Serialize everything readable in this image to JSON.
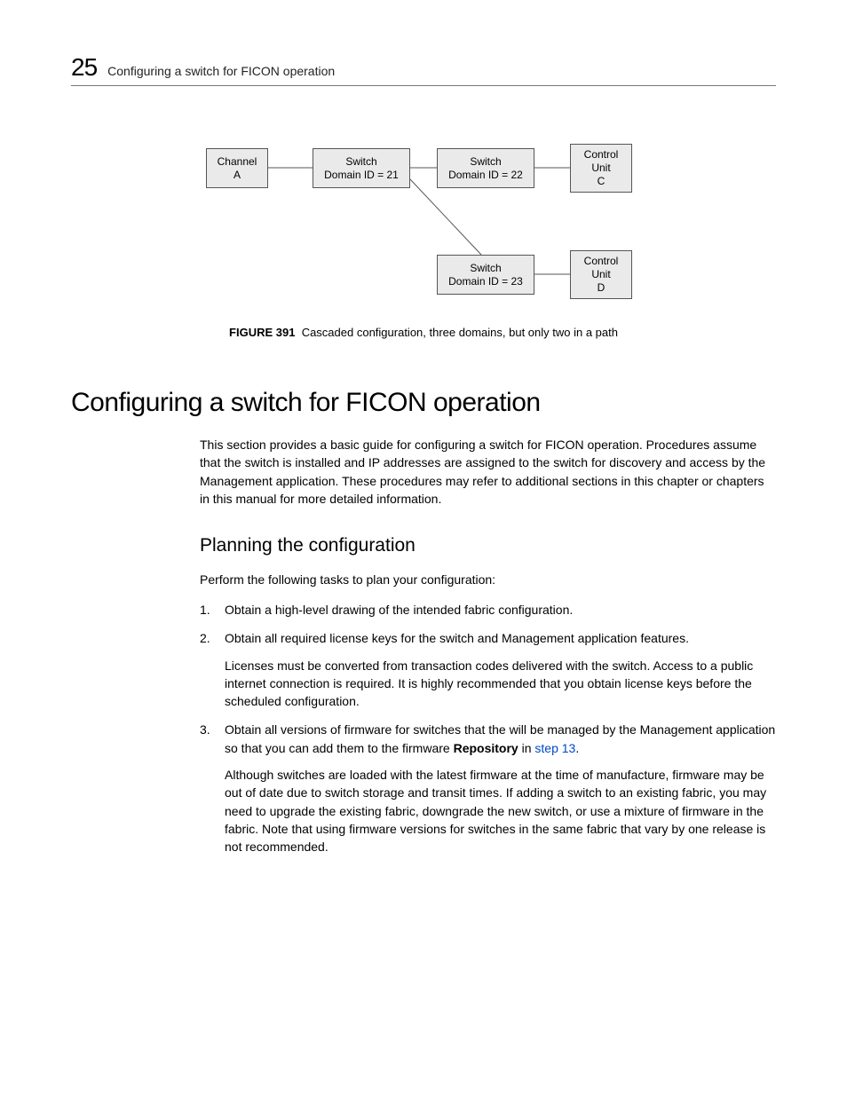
{
  "header": {
    "chapter": "25",
    "title": "Configuring a switch for FICON operation"
  },
  "chart_data": {
    "type": "diagram",
    "nodes": [
      {
        "id": "channelA",
        "lines": [
          "Channel",
          "A"
        ]
      },
      {
        "id": "sw21",
        "lines": [
          "Switch",
          "Domain ID = 21"
        ]
      },
      {
        "id": "sw22",
        "lines": [
          "Switch",
          "Domain ID = 22"
        ]
      },
      {
        "id": "cuC",
        "lines": [
          "Control",
          "Unit",
          "C"
        ]
      },
      {
        "id": "sw23",
        "lines": [
          "Switch",
          "Domain ID = 23"
        ]
      },
      {
        "id": "cuD",
        "lines": [
          "Control",
          "Unit",
          "D"
        ]
      }
    ],
    "edges": [
      [
        "channelA",
        "sw21"
      ],
      [
        "sw21",
        "sw22"
      ],
      [
        "sw22",
        "cuC"
      ],
      [
        "sw21",
        "sw23"
      ],
      [
        "sw23",
        "cuD"
      ]
    ]
  },
  "figure": {
    "label": "FIGURE 391",
    "caption": "Cascaded configuration, three domains, but only two in a path"
  },
  "section": {
    "title": "Configuring a switch for FICON operation",
    "intro": "This section provides a basic guide for configuring a switch for FICON operation. Procedures assume that the switch is installed and IP addresses are assigned to the switch for discovery and access by the Management application. These procedures may refer to additional sections in this chapter or chapters in this manual for more detailed information."
  },
  "subsection": {
    "title": "Planning the configuration",
    "lead": "Perform the following tasks to plan your configuration:",
    "steps": {
      "s1": "Obtain a high-level drawing of the intended fabric configuration.",
      "s2": "Obtain all required license keys for the switch and Management application features.",
      "s2_detail": "Licenses must be converted from transaction codes delivered with the switch. Access to a public internet connection is required. It is highly recommended that you obtain license keys before the scheduled configuration.",
      "s3_a": "Obtain all versions of firmware for switches that the will be managed by the Management application so that you can add them to the firmware ",
      "s3_bold": "Repository",
      "s3_b": " in ",
      "s3_link": "step 13",
      "s3_c": ".",
      "s3_detail": "Although switches are loaded with the latest firmware at the time of manufacture, firmware may be out of date due to switch storage and transit times. If adding a switch to an existing fabric, you may need to upgrade the existing fabric, downgrade the new switch, or use a mixture of firmware in the fabric. Note that using firmware versions for switches in the same fabric that vary by one release is not recommended."
    }
  }
}
